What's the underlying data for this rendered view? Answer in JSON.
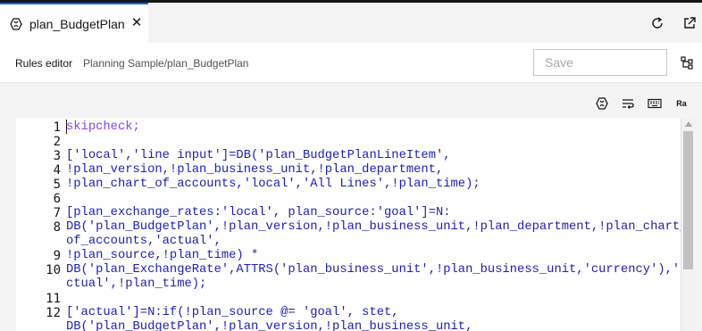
{
  "tab": {
    "title": "plan_BudgetPlan",
    "close": "✕"
  },
  "top_actions": [
    {
      "name": "refresh-icon"
    },
    {
      "name": "open-external-icon"
    }
  ],
  "breadcrumb": {
    "rules_editor": "Rules editor",
    "path": "Planning Sample/plan_BudgetPlan"
  },
  "save": {
    "label": "Save"
  },
  "toolbar": [
    {
      "name": "cube-icon"
    },
    {
      "name": "wrap-text-icon"
    },
    {
      "name": "keyboard-icon"
    },
    {
      "name": "format-icon",
      "label": "Ra"
    }
  ],
  "editor": {
    "line_numbers": [
      "1",
      "2",
      "3",
      "4",
      "5",
      "6",
      "7",
      "8",
      "9",
      "10",
      "11",
      "12"
    ],
    "code_lines": [
      "skipcheck;",
      "",
      "['local','line input']=DB('plan_BudgetPlanLineItem',",
      "!plan_version,!plan_business_unit,!plan_department,",
      "!plan_chart_of_accounts,'local','All Lines',!plan_time);",
      "",
      "[plan_exchange_rates:'local', plan_source:'goal']=N:",
      "DB('plan_BudgetPlan',!plan_version,!plan_business_unit,!plan_department,!plan_chart_",
      "of_accounts,'actual',",
      "!plan_source,!plan_time) *",
      "DB('plan_ExchangeRate',ATTRS('plan_business_unit',!plan_business_unit,'currency'),'a",
      "ctual',!plan_time);",
      "",
      "['actual']=N:if(!plan_source @= 'goal', stet,",
      "DB('plan_BudgetPlan',!plan_version,!plan_business_unit,"
    ]
  },
  "colors": {
    "accent": "#0f62fe",
    "keyword": "#8a3ffc",
    "code": "#1a1fb5"
  }
}
